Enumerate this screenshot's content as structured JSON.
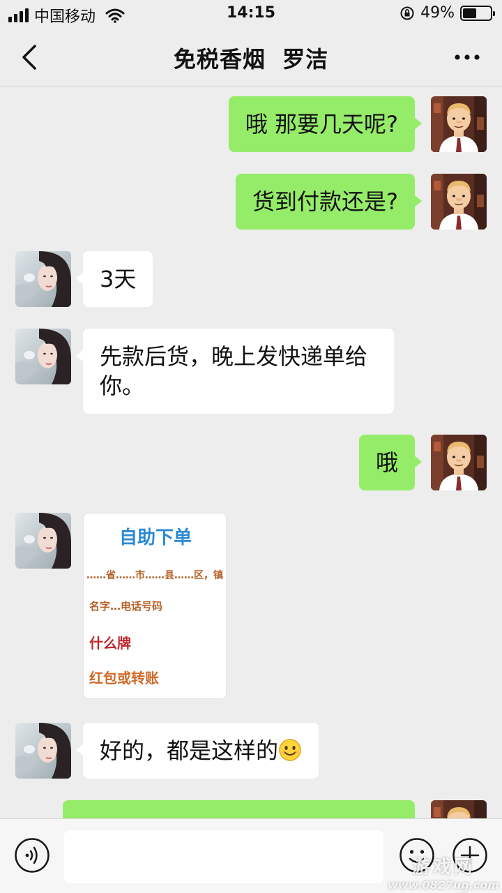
{
  "status_bar": {
    "carrier": "中国移动",
    "time": "14:15",
    "battery_percent_text": "49%",
    "battery_level": 0.49,
    "signal_bars": 4
  },
  "header": {
    "title": "免税香烟  罗洁",
    "back_icon": "chevron-left-icon",
    "more_icon": "more-dots-icon"
  },
  "messages": [
    {
      "from": "self",
      "type": "text",
      "text": "哦  那要几天呢?"
    },
    {
      "from": "self",
      "type": "text",
      "text": "货到付款还是?"
    },
    {
      "from": "contact",
      "type": "text",
      "text": "3天"
    },
    {
      "from": "contact",
      "type": "text",
      "text": "先款后货，晚上发快递单给你。"
    },
    {
      "from": "self",
      "type": "text",
      "text": "哦"
    },
    {
      "from": "contact",
      "type": "image",
      "image_card": {
        "title": "自助下单",
        "line1": "……省……市……县……区，镇",
        "line2": "名字…电话号码",
        "line3": "什么牌",
        "line4": "红包或转账"
      }
    },
    {
      "from": "contact",
      "type": "text",
      "text": "好的，都是这样的",
      "emoji": "smile-emoji"
    },
    {
      "from": "self",
      "type": "text",
      "text": ""
    }
  ],
  "input_bar": {
    "placeholder": "",
    "voice_icon": "voice-icon",
    "emoji_icon": "emoji-icon",
    "plus_icon": "plus-icon"
  },
  "watermark": {
    "main": "游戏网",
    "url": "www.0827ug.com"
  },
  "colors": {
    "background": "#ededed",
    "outgoing_bubble": "#95ec69",
    "incoming_bubble": "#ffffff"
  }
}
